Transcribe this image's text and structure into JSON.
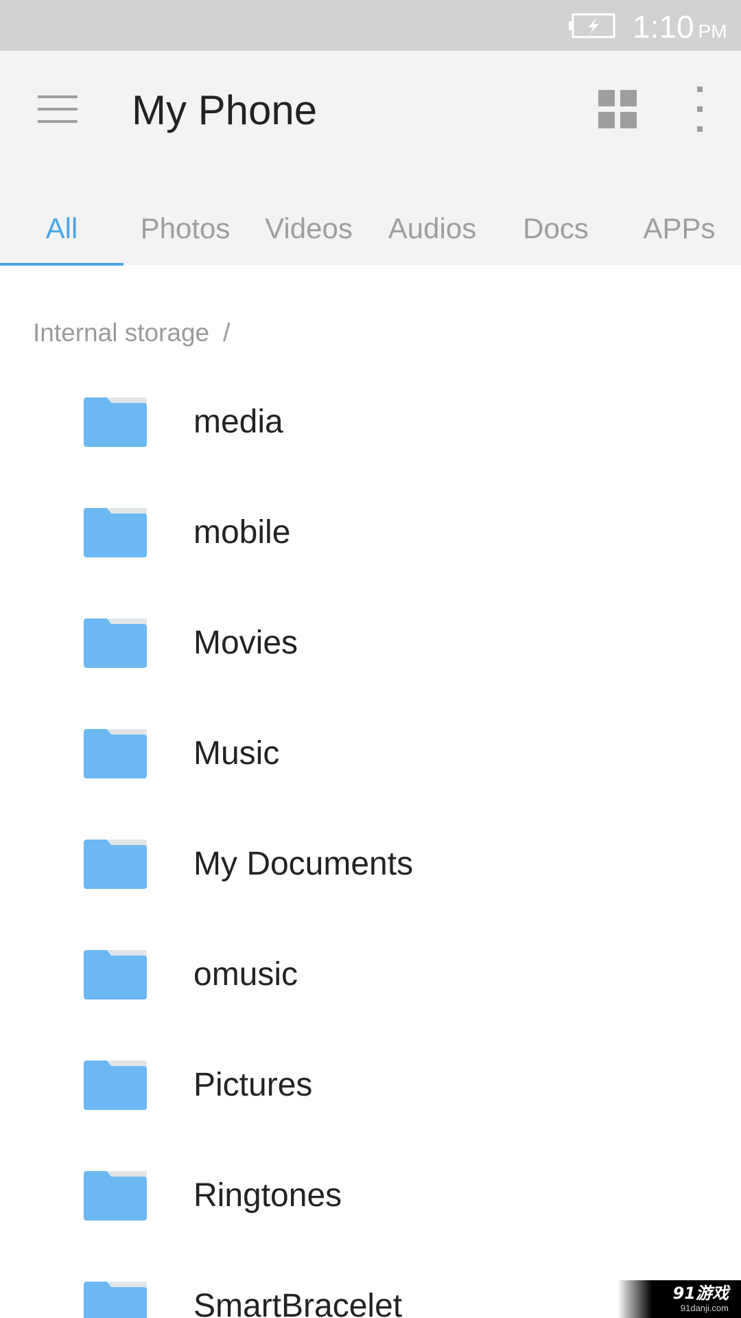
{
  "status_bar": {
    "time": "1:10",
    "ampm": "PM",
    "battery_icon": "battery-charging-icon"
  },
  "app_bar": {
    "title": "My Phone",
    "menu_icon": "hamburger-menu-icon",
    "grid_icon": "grid-view-icon",
    "more_icon": "more-vertical-icon"
  },
  "tabs": [
    {
      "label": "All",
      "active": true
    },
    {
      "label": "Photos",
      "active": false
    },
    {
      "label": "Videos",
      "active": false
    },
    {
      "label": "Audios",
      "active": false
    },
    {
      "label": "Docs",
      "active": false
    },
    {
      "label": "APPs",
      "active": false
    }
  ],
  "breadcrumb": {
    "location": "Internal storage",
    "separator": "/"
  },
  "files": [
    {
      "name": "media",
      "icon": "folder-icon"
    },
    {
      "name": "mobile",
      "icon": "folder-icon"
    },
    {
      "name": "Movies",
      "icon": "folder-icon"
    },
    {
      "name": "Music",
      "icon": "folder-icon"
    },
    {
      "name": "My Documents",
      "icon": "folder-icon"
    },
    {
      "name": "omusic",
      "icon": "folder-icon"
    },
    {
      "name": "Pictures",
      "icon": "folder-icon"
    },
    {
      "name": "Ringtones",
      "icon": "folder-icon"
    },
    {
      "name": "SmartBracelet",
      "icon": "folder-icon"
    }
  ],
  "watermark": {
    "logo": "91游戏",
    "url": "91danji.com"
  },
  "colors": {
    "accent": "#4aa5e8",
    "folder": "#6cb8f2",
    "status_bar": "#d1d1d3",
    "app_bar": "#f3f3f5"
  }
}
